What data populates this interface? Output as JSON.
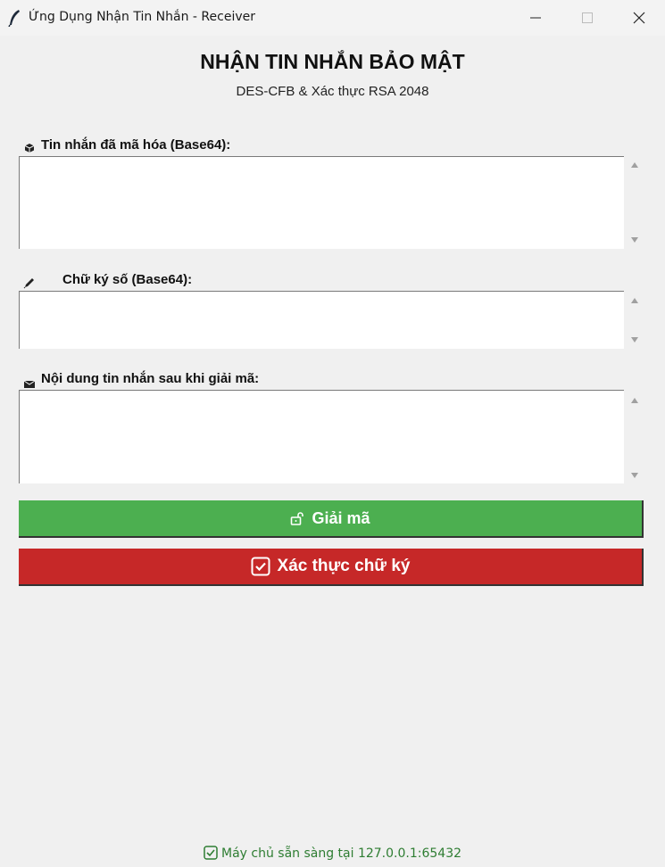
{
  "window": {
    "title": "Ứng Dụng Nhận Tin Nhắn - Receiver"
  },
  "header": {
    "title": "NHẬN TIN NHẮN BẢO MẬT",
    "subtitle": "DES-CFB & Xác thực RSA 2048"
  },
  "fields": {
    "encrypted": {
      "label": "Tin nhắn đã mã hóa (Base64):",
      "value": "",
      "icon": "package-icon"
    },
    "signature": {
      "label": "Chữ ký số (Base64):",
      "value": "",
      "icon": "pen-icon"
    },
    "decrypted": {
      "label": "Nội dung tin nhắn sau khi giải mã:",
      "value": "",
      "icon": "envelope-icon"
    }
  },
  "buttons": {
    "decrypt": {
      "label": "Giải mã",
      "icon": "unlock-icon",
      "color": "#4caf50"
    },
    "verify": {
      "label": "Xác thực chữ ký",
      "icon": "check-box-icon",
      "color": "#c62828"
    }
  },
  "status": {
    "text": "Máy chủ sẵn sàng tại 127.0.0.1:65432",
    "icon": "check-box-icon",
    "color": "#2e7d32"
  }
}
